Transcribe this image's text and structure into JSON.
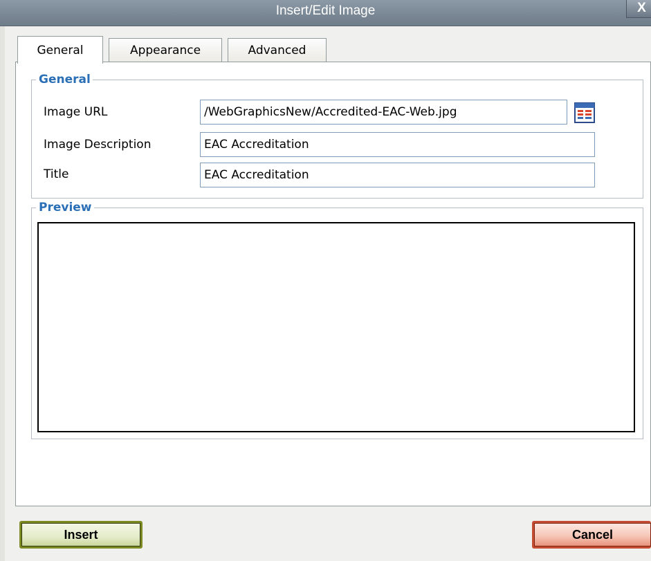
{
  "window": {
    "title": "Insert/Edit Image",
    "close_label": "X"
  },
  "tabs": [
    {
      "label": "General",
      "active": true
    },
    {
      "label": "Appearance",
      "active": false
    },
    {
      "label": "Advanced",
      "active": false
    }
  ],
  "general": {
    "legend": "General",
    "image_url_label": "Image URL",
    "image_url_value": "/WebGraphicsNew/Accredited-EAC-Web.jpg",
    "image_description_label": "Image Description",
    "image_description_value": "EAC Accreditation",
    "title_label": "Title",
    "title_value": "EAC Accreditation",
    "browse_icon": "file-browser-icon"
  },
  "preview": {
    "legend": "Preview"
  },
  "buttons": {
    "insert_label": "Insert",
    "cancel_label": "Cancel"
  },
  "colors": {
    "legend_text": "#2b6fb6",
    "titlebar": "#7c8996",
    "insert_border": "#7e8a24",
    "cancel_border": "#c44d34"
  }
}
